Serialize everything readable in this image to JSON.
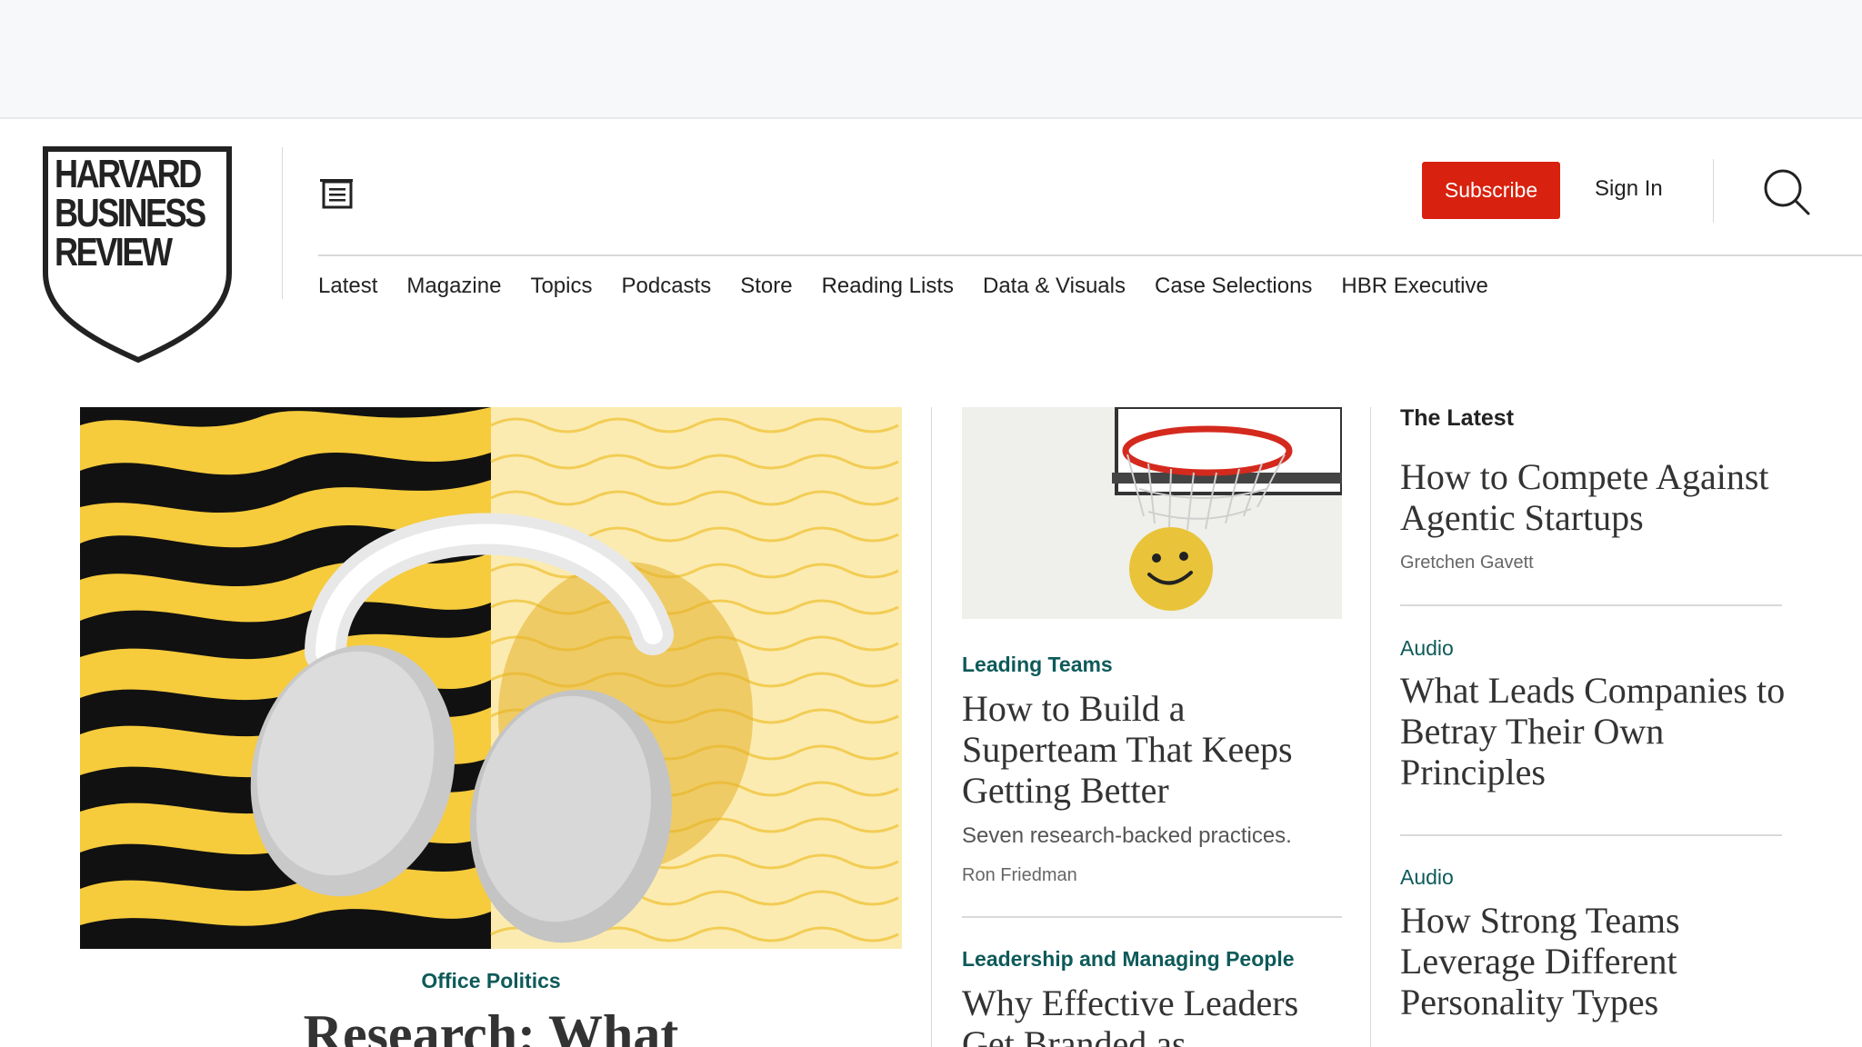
{
  "brand": {
    "logo_lines": [
      "HARVARD",
      "BUSINESS",
      "REVIEW"
    ]
  },
  "header": {
    "subscribe_label": "Subscribe",
    "signin_label": "Sign In"
  },
  "nav": {
    "items": [
      "Latest",
      "Magazine",
      "Topics",
      "Podcasts",
      "Store",
      "Reading Lists",
      "Data & Visuals",
      "Case Selections",
      "HBR Executive"
    ]
  },
  "hero": {
    "image_desc": "headphones-on-tiger-stripes",
    "category": "Office Politics",
    "title": "Research: What"
  },
  "middle": {
    "image_desc": "smiley-ball-in-basketball-hoop",
    "story1": {
      "category": "Leading Teams",
      "title": "How to Build a Superteam That Keeps Getting Better",
      "dek": "Seven research-backed practices.",
      "author": "Ron Friedman"
    },
    "story2": {
      "category": "Leadership and Managing People",
      "title": "Why Effective Leaders Get Branded as"
    }
  },
  "latest": {
    "heading": "The Latest",
    "items": [
      {
        "label": "",
        "title": "How to Compete Against Agentic Startups",
        "author": "Gretchen Gavett"
      },
      {
        "label": "Audio",
        "title": "What Leads Companies to Betray Their Own Principles",
        "author": ""
      },
      {
        "label": "Audio",
        "title": "How Strong Teams Leverage Different Personality Types",
        "author": ""
      }
    ]
  },
  "colors": {
    "accent_red": "#d8210e",
    "category_teal": "#0e5a5a",
    "stripe_yellow": "#f6cb3c",
    "wave_cream": "#fcebb0"
  }
}
